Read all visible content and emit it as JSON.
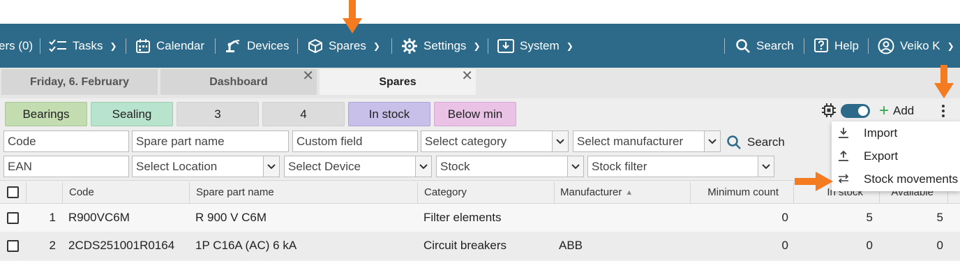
{
  "navbar": {
    "items": [
      {
        "label": "ers (0)"
      },
      {
        "label": "Tasks"
      },
      {
        "label": "Calendar"
      },
      {
        "label": "Devices"
      },
      {
        "label": "Spares"
      },
      {
        "label": "Settings"
      },
      {
        "label": "System"
      }
    ],
    "search_label": "Search",
    "help_label": "Help",
    "user_label": "Veiko K",
    "bg_color": "#2d6a8a"
  },
  "tabs": [
    {
      "label": "Friday, 6. February",
      "closable": false
    },
    {
      "label": "Dashboard",
      "closable": true
    },
    {
      "label": "Spares",
      "closable": true,
      "active": true
    }
  ],
  "filter_chips": [
    {
      "label": "Bearings",
      "color": "#c3ddb0"
    },
    {
      "label": "Sealing",
      "color": "#b8e3cc"
    },
    {
      "label": "3",
      "color": "#dcdcdc"
    },
    {
      "label": "4",
      "color": "#dcdcdc"
    },
    {
      "label": "In stock",
      "color": "#c9c0ea"
    },
    {
      "label": "Below min",
      "color": "#e9c2e6"
    }
  ],
  "filters": {
    "code": "Code",
    "spare_part_name": "Spare part name",
    "custom_field": "Custom field",
    "select_category": "Select category",
    "select_manufacturer": "Select manufacturer",
    "search_label": "Search",
    "ean": "EAN",
    "select_location": "Select Location",
    "select_device": "Select Device",
    "stock": "Stock",
    "stock_filter": "Stock filter"
  },
  "toolbar": {
    "add_label": "Add"
  },
  "menu": {
    "items": [
      {
        "label": "Import",
        "icon": "download-icon"
      },
      {
        "label": "Export",
        "icon": "upload-icon"
      },
      {
        "label": "Stock movements",
        "icon": "swap-icon"
      }
    ]
  },
  "table": {
    "columns": [
      "Code",
      "Spare part name",
      "Category",
      "Manufacturer",
      "Minimum count",
      "In stock",
      "Available"
    ],
    "rows": [
      {
        "index": "1",
        "code": "R900VC6M",
        "name": "R 900 V C6M",
        "category": "Filter elements",
        "manufacturer": "",
        "min_count": "0",
        "in_stock": "5",
        "available": "5"
      },
      {
        "index": "2",
        "code": "2CDS251001R0164",
        "name": "1P C16A (AC) 6 kA",
        "category": "Circuit breakers",
        "manufacturer": "ABB",
        "min_count": "0",
        "in_stock": "0",
        "available": "0"
      }
    ]
  },
  "annotation_color": "#f47b20"
}
